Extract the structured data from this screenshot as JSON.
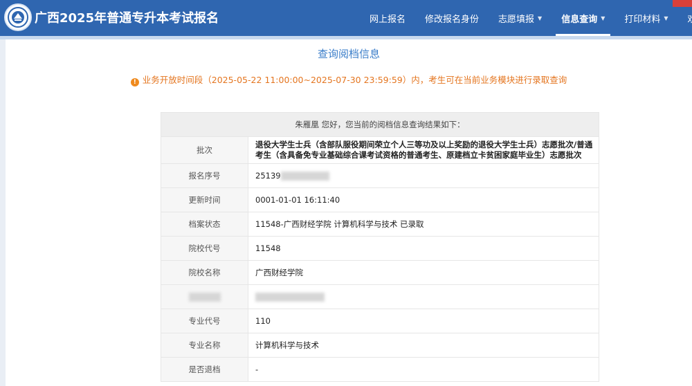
{
  "header": {
    "title": "广西2025年普通专升本考试报名",
    "nav": [
      {
        "label": "网上报名",
        "has_dropdown": false,
        "active": false
      },
      {
        "label": "修改报名身份",
        "has_dropdown": false,
        "active": false
      },
      {
        "label": "志愿填报",
        "has_dropdown": true,
        "active": false
      },
      {
        "label": "信息查询",
        "has_dropdown": true,
        "active": true
      },
      {
        "label": "打印材料",
        "has_dropdown": true,
        "active": false
      },
      {
        "label": "欢",
        "has_dropdown": false,
        "active": false
      }
    ]
  },
  "page": {
    "title": "查询阅档信息",
    "notice": "业务开放时间段（2025-05-22 11:00:00~2025-07-30 23:59:59）内，考生可在当前业务模块进行录取查询"
  },
  "result": {
    "heading": "朱雁凰 您好，您当前的阅档信息查询结果如下：",
    "rows": [
      {
        "label": "批次",
        "value": "退役大学生士兵（含部队服役期间荣立个人三等功及以上奖励的退役大学生士兵）志愿批次/普通考生（含具备免专业基础综合课考试资格的普通考生、原建档立卡贫困家庭毕业生）志愿批次"
      },
      {
        "label": "报名序号",
        "value": "25139"
      },
      {
        "label": "更新时间",
        "value": "0001-01-01 16:11:40"
      },
      {
        "label": "档案状态",
        "value": "11548-广西财经学院 计算机科学与技术 已录取"
      },
      {
        "label": "院校代号",
        "value": "11548"
      },
      {
        "label": "院校名称",
        "value": "广西财经学院"
      },
      {
        "label": "",
        "value": ""
      },
      {
        "label": "专业代号",
        "value": "110"
      },
      {
        "label": "专业名称",
        "value": "计算机科学与技术"
      },
      {
        "label": "是否退档",
        "value": "-"
      }
    ]
  },
  "colors": {
    "header_bg": "#2f66b0",
    "accent": "#3a7dc9",
    "notice": "#e4751f"
  }
}
